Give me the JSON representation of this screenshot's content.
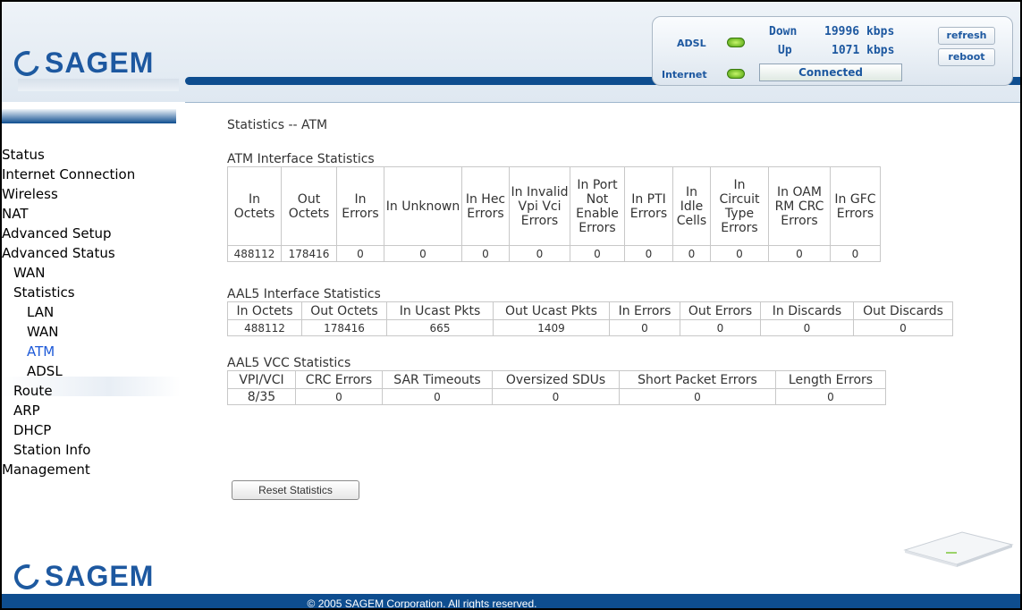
{
  "brand": {
    "logo_text": "SAGEM"
  },
  "status_panel": {
    "adsl_label": "ADSL",
    "internet_label": "Internet",
    "down_label": "Down",
    "down_rate": "19996 kbps",
    "up_label": "Up",
    "up_rate": "1071 kbps",
    "connection_status": "Connected",
    "refresh_label": "refresh",
    "reboot_label": "reboot",
    "led_color": "#6fd12a"
  },
  "sidebar": {
    "items": [
      {
        "label": "Status",
        "level": 0
      },
      {
        "label": "Internet Connection",
        "level": 0
      },
      {
        "label": "Wireless",
        "level": 0
      },
      {
        "label": "NAT",
        "level": 0
      },
      {
        "label": "Advanced Setup",
        "level": 0
      },
      {
        "label": "Advanced Status",
        "level": 0
      },
      {
        "label": "WAN",
        "level": 1
      },
      {
        "label": "Statistics",
        "level": 1
      },
      {
        "label": "LAN",
        "level": 2
      },
      {
        "label": "WAN",
        "level": 2
      },
      {
        "label": "ATM",
        "level": 2,
        "active": true
      },
      {
        "label": "ADSL",
        "level": 2
      },
      {
        "label": "Route",
        "level": 1
      },
      {
        "label": "ARP",
        "level": 1
      },
      {
        "label": "DHCP",
        "level": 1
      },
      {
        "label": "Station Info",
        "level": 1
      },
      {
        "label": "Management",
        "level": 0
      }
    ]
  },
  "page_title": "Statistics -- ATM",
  "atm_interface": {
    "title": "ATM Interface Statistics",
    "headers": [
      "In Octets",
      "Out Octets",
      "In Errors",
      "In Unknown",
      "In Hec Errors",
      "In Invalid Vpi Vci Errors",
      "In Port Not Enable Errors",
      "In PTI Errors",
      "In Idle Cells",
      "In Circuit Type Errors",
      "In OAM RM CRC Errors",
      "In GFC Errors"
    ],
    "values": [
      "488112",
      "178416",
      "0",
      "0",
      "0",
      "0",
      "0",
      "0",
      "0",
      "0",
      "0",
      "0"
    ]
  },
  "aal5_interface": {
    "title": "AAL5 Interface Statistics",
    "headers": [
      "In Octets",
      "Out Octets",
      "In Ucast Pkts",
      "Out Ucast Pkts",
      "In Errors",
      "Out Errors",
      "In Discards",
      "Out Discards"
    ],
    "values": [
      "488112",
      "178416",
      "665",
      "1409",
      "0",
      "0",
      "0",
      "0"
    ]
  },
  "aal5_vcc": {
    "title": "AAL5 VCC Statistics",
    "headers": [
      "VPI/VCI",
      "CRC Errors",
      "SAR Timeouts",
      "Oversized SDUs",
      "Short Packet Errors",
      "Length Errors"
    ],
    "values": [
      "8/35",
      "0",
      "0",
      "0",
      "0",
      "0"
    ]
  },
  "reset_button_label": "Reset Statistics",
  "footer": "© 2005 SAGEM Corporation. All rights reserved."
}
